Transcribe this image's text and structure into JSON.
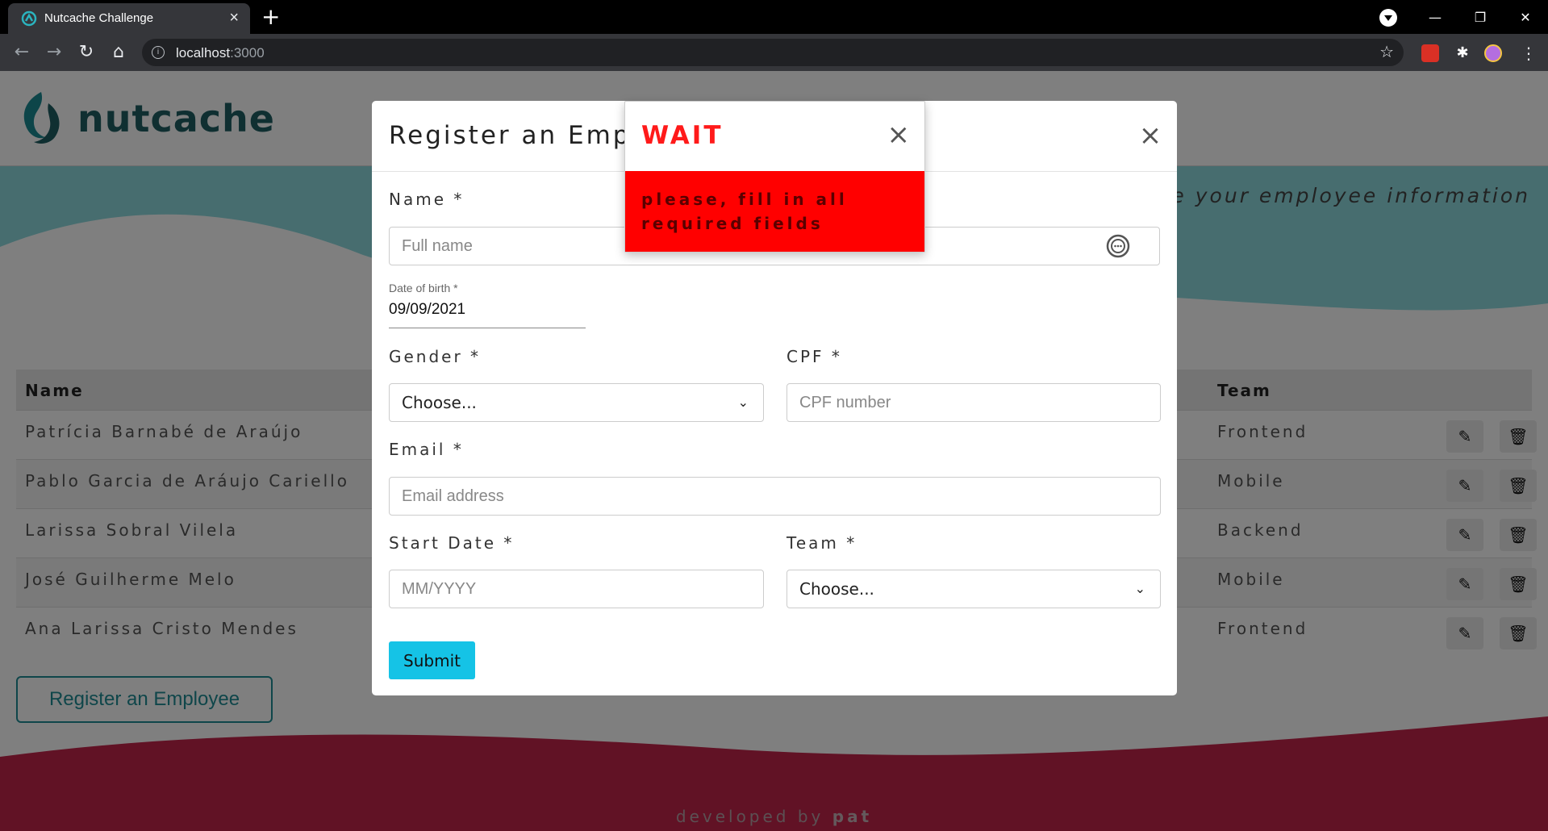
{
  "browser": {
    "tab_title": "Nutcache Challenge",
    "url_host": "localhost",
    "url_port": ":3000"
  },
  "header": {
    "logo_text": "nutcache"
  },
  "hero": {
    "tagline": "nize your employee information"
  },
  "table": {
    "columns": {
      "name": "Name",
      "team": "Team"
    },
    "rows": [
      {
        "name": "Patrícia Barnabé de Araújo",
        "team": "Frontend"
      },
      {
        "name": "Pablo Garcia de Aráujo Cariello",
        "team": "Mobile"
      },
      {
        "name": "Larissa Sobral Vilela",
        "team": "Backend"
      },
      {
        "name": "José Guilherme Melo",
        "team": "Mobile"
      },
      {
        "name": "Ana Larissa Cristo Mendes",
        "team": "Frontend"
      }
    ]
  },
  "register_button": "Register an Employee",
  "footer": {
    "prefix": "developed by ",
    "author": "pat"
  },
  "modal": {
    "title": "Register an Employee",
    "name_label": "Name *",
    "name_placeholder": "Full name",
    "dob_label": "Date of birth *",
    "dob_value": "09/09/2021",
    "gender_label": "Gender *",
    "gender_value": "Choose...",
    "cpf_label": "CPF *",
    "cpf_placeholder": "CPF number",
    "email_label": "Email *",
    "email_placeholder": "Email address",
    "start_label": "Start Date *",
    "start_placeholder": "MM/YYYY",
    "team_label": "Team *",
    "team_value": "Choose...",
    "submit": "Submit"
  },
  "toast": {
    "title": "WAIT",
    "message": "please, fill in all required fields"
  },
  "colors": {
    "teal": "#1e8c95",
    "alert_red": "#ff0000",
    "submit_cyan": "#15c3e6",
    "footer_wave": "#7a1c2e"
  }
}
